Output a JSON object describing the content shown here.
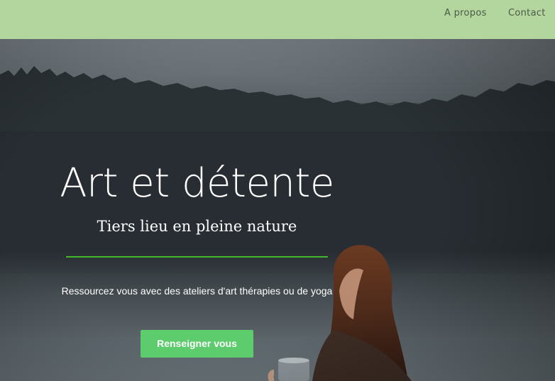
{
  "nav": {
    "links": [
      {
        "label": "A propos"
      },
      {
        "label": "Contact"
      }
    ]
  },
  "hero": {
    "title": "Art et détente",
    "subtitle": "Tiers lieu en pleine nature",
    "text": "Ressourcez vous avec des ateliers d'art thérapies ou de yoga",
    "cta_label": "Renseigner vous"
  },
  "colors": {
    "navbar": "#b2d69e",
    "accent_line": "#45b52c",
    "button": "#5ccc6c",
    "text": "#ffffff"
  }
}
